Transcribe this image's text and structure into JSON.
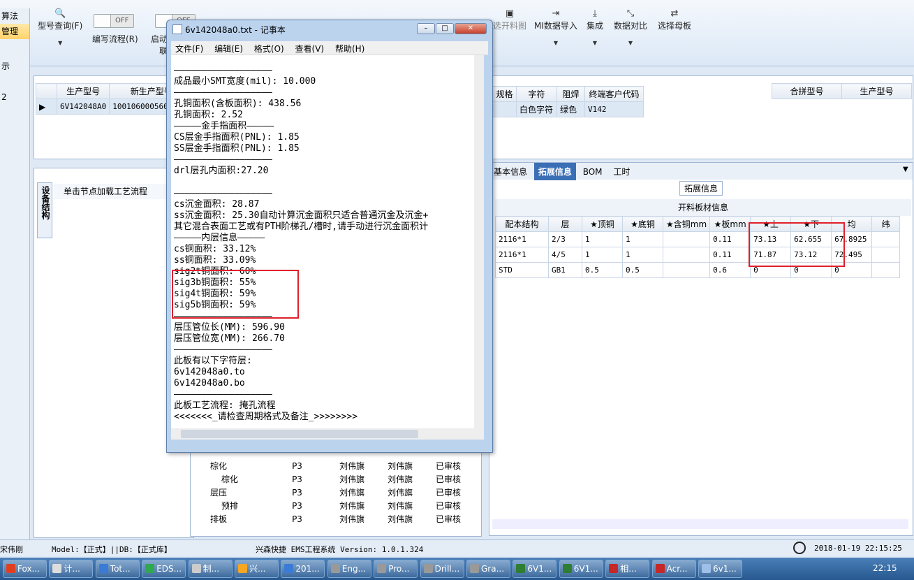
{
  "ribbon": {
    "items": [
      {
        "label": "型号查询(F)",
        "icon": "search-icon"
      },
      {
        "label": "编写流程(R)"
      },
      {
        "label": "启动"
      },
      {
        "label": "选开料图"
      },
      {
        "label": "MI数据导入"
      },
      {
        "label": "集成"
      },
      {
        "label": "数据对比"
      },
      {
        "label": "选择母板"
      }
    ],
    "toggle_off": "OFF",
    "left_fragment": "联"
  },
  "leftnav": {
    "items": [
      "算法",
      "管理",
      "示",
      "2"
    ]
  },
  "top_grid": {
    "headers_left": [
      "生产型号",
      "新生产型号"
    ],
    "row_left": [
      "6V142048A0",
      "10010600056087"
    ],
    "headers_right": [
      "规格",
      "字符",
      "阻焊",
      "终端客户代码"
    ],
    "row_right": [
      "",
      "白色字符",
      "绿色",
      "V142"
    ],
    "headers_far": [
      "合拼型号",
      "生产型号"
    ]
  },
  "flow_panel": {
    "vertical_tab": "设备结构",
    "title": "单击节点加载工艺流程"
  },
  "right_tabs": {
    "tabs": [
      "基本信息",
      "拓展信息",
      "BOM",
      "工时"
    ],
    "active": "拓展信息",
    "group_label": "拓展信息",
    "table_title": "开料板材信息"
  },
  "material_table": {
    "headers": [
      "配本结构",
      "层",
      "★顶铜",
      "★底铜",
      "★含铜mm",
      "★板mm",
      "★上",
      "★下",
      "均",
      "纬"
    ],
    "rows": [
      [
        "2116*1",
        "2/3",
        "1",
        "1",
        "",
        "0.11",
        "73.13",
        "62.655",
        "67.8925",
        ""
      ],
      [
        "2116*1",
        "4/5",
        "1",
        "1",
        "",
        "0.11",
        "71.87",
        "73.12",
        "72.495",
        ""
      ],
      [
        "STD",
        "GB1",
        "0.5",
        "0.5",
        "",
        "0.6",
        "0",
        "0",
        "0",
        ""
      ]
    ]
  },
  "tree": {
    "rows": [
      [
        "棕化",
        "P3",
        "刘伟旗",
        "刘伟旗",
        "已审核"
      ],
      [
        "棕化",
        "P3",
        "刘伟旗",
        "刘伟旗",
        "已审核"
      ],
      [
        "层压",
        "P3",
        "刘伟旗",
        "刘伟旗",
        "已审核"
      ],
      [
        "预排",
        "P3",
        "刘伟旗",
        "刘伟旗",
        "已审核"
      ],
      [
        "排板",
        "P3",
        "刘伟旗",
        "刘伟旗",
        "已审核"
      ]
    ]
  },
  "notepad": {
    "title": "6v142048a0.txt - 记事本",
    "menu": [
      "文件(F)",
      "编辑(E)",
      "格式(O)",
      "查看(V)",
      "帮助(H)"
    ],
    "text": "——————————————————\n成品最小SMT宽度(mil): 10.000\n——————————————————\n孔铜面积(含板面积): 438.56\n孔铜面积: 2.52\n—————金手指面积—————\nCS层金手指面积(PNL): 1.85\nSS层金手指面积(PNL): 1.85\n——————————————————\ndrl层孔内面积:27.20\n\n——————————————————\ncs沉金面积: 28.87\nss沉金面积: 25.30自动计算沉金面积只适合普通沉金及沉金+\n其它混合表面工艺或有PTH阶梯孔/槽时,请手动进行沉金面积计\n—————内层信息—————\ncs铜面积: 33.12%\nss铜面积: 33.09%\nsig2t铜面积: 60%\nsig3b铜面积: 55%\nsig4t铜面积: 59%\nsig5b铜面积: 59%\n——————————————————\n层压管位长(MM): 596.90\n层压管位宽(MM): 266.70\n——————————————————\n此板有以下字符层:\n6v142048a0.to\n6v142048a0.bo\n——————————————————\n此板工艺流程: 掩孔流程\n<<<<<<<_请检查周期格式及备注_>>>>>>>>"
  },
  "status": {
    "user": "宋伟刚",
    "model_db": "Model:【正式】||DB:【正式库】",
    "app": "兴森快捷 EMS工程系统 Version: 1.0.1.324",
    "datetime": "2018-01-19 22:15:25"
  },
  "taskbar": {
    "items": [
      "Fox...",
      "计...",
      "Tot...",
      "EDS...",
      "制...",
      "兴...",
      "201...",
      "Eng...",
      "Pro...",
      "Drill...",
      "Gra...",
      "6V1...",
      "6V1...",
      "相...",
      "Acr...",
      "6v1..."
    ],
    "clock": "22:15"
  }
}
